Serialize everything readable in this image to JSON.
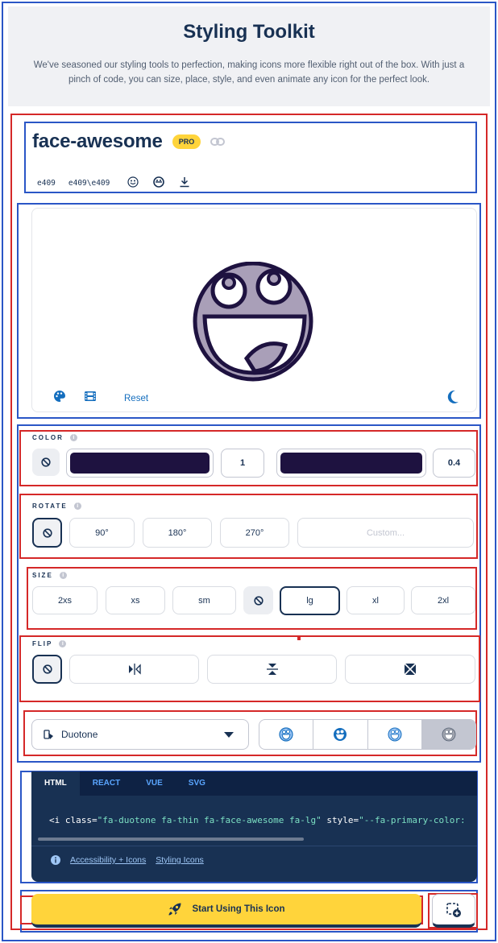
{
  "header": {
    "title": "Styling Toolkit",
    "description": "We've seasoned our styling tools to perfection, making icons more flexible right out of the box. With just a pinch of code, you can size, place, style, and even animate any icon for the perfect look."
  },
  "icon": {
    "name": "face-awesome",
    "badge": "PRO",
    "unicode": "e409",
    "unicode_escaped": "e409\\e409"
  },
  "preview": {
    "reset_label": "Reset",
    "primary_color": "#1e1240",
    "secondary_color": "#a99fb8"
  },
  "color": {
    "label": "COLOR",
    "primary_swatch": "#1e1240",
    "primary_opacity": "1",
    "secondary_swatch": "#1e1240",
    "secondary_opacity": "0.4"
  },
  "rotate": {
    "label": "ROTATE",
    "options": [
      "90°",
      "180°",
      "270°"
    ],
    "custom_placeholder": "Custom..."
  },
  "size": {
    "label": "SIZE",
    "options": [
      "2xs",
      "xs",
      "sm",
      "lg",
      "xl",
      "2xl"
    ],
    "selected": "lg"
  },
  "flip": {
    "label": "FLIP"
  },
  "family": {
    "selected": "Duotone"
  },
  "code": {
    "tabs": [
      "HTML",
      "REACT",
      "VUE",
      "SVG"
    ],
    "active_tab": "HTML",
    "line_prefix": "<i class=",
    "class_value": "\"fa-duotone fa-thin fa-face-awesome fa-lg\"",
    "style_attr": " style=",
    "style_value": "\"--fa-primary-color:",
    "link_accessibility": "Accessibility + Icons",
    "link_styling": "Styling Icons"
  },
  "cta": {
    "start_label": "Start Using This Icon"
  }
}
